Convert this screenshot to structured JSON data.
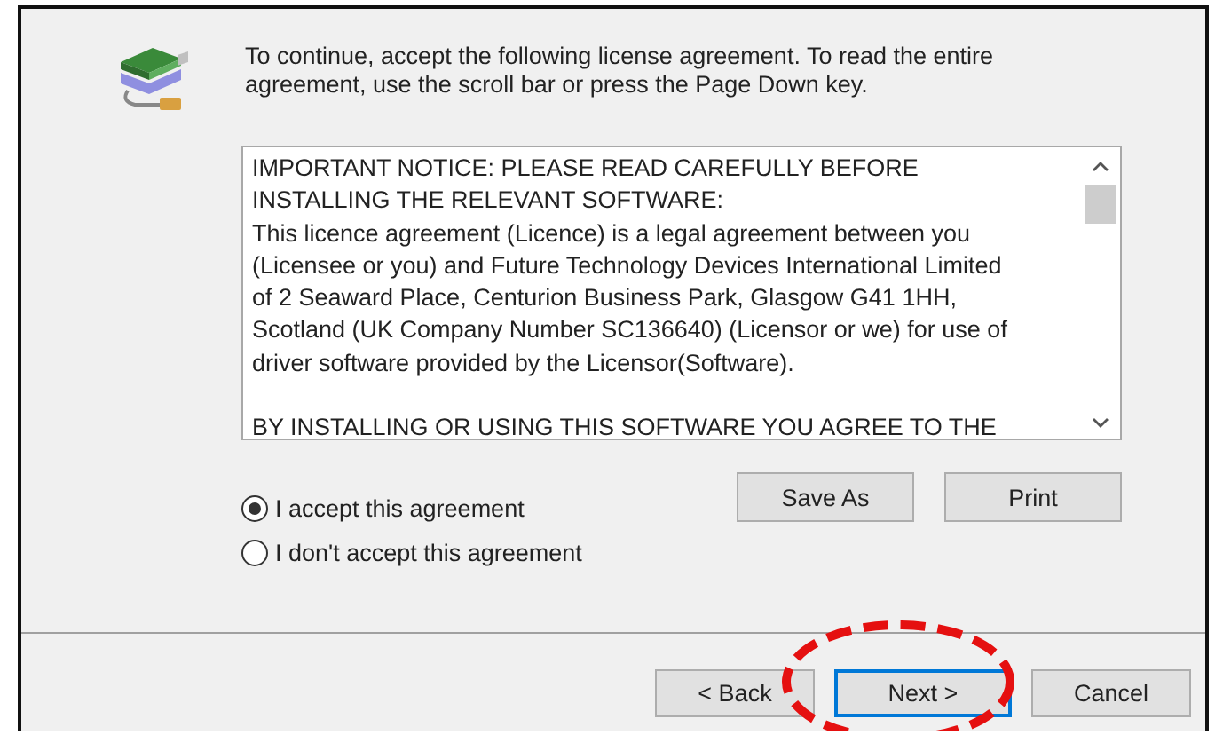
{
  "header": {
    "instructions": [
      "To continue, accept the following license agreement. To read the entire",
      "agreement, use the scroll bar or press the Page Down key."
    ]
  },
  "license": {
    "paragraphs": [
      [
        "IMPORTANT NOTICE: PLEASE READ CAREFULLY BEFORE",
        "INSTALLING THE RELEVANT SOFTWARE:",
        "This licence agreement (Licence) is a legal agreement between you",
        "(Licensee or you) and Future Technology Devices International Limited",
        "of 2 Seaward Place, Centurion Business Park, Glasgow G41 1HH,",
        "Scotland (UK Company Number SC136640) (Licensor or we) for use of",
        "driver software provided by the Licensor(Software)."
      ],
      [
        "BY INSTALLING OR USING THIS SOFTWARE YOU AGREE TO THE"
      ]
    ]
  },
  "options": [
    {
      "label": "I accept this agreement",
      "selected": true
    },
    {
      "label": "I don't accept this agreement",
      "selected": false
    }
  ],
  "actions": [
    "Save As",
    "Print"
  ],
  "nav_buttons": [
    {
      "label": "< Back",
      "default": false
    },
    {
      "label": "Next >",
      "default": true
    },
    {
      "label": "Cancel",
      "default": false
    }
  ]
}
